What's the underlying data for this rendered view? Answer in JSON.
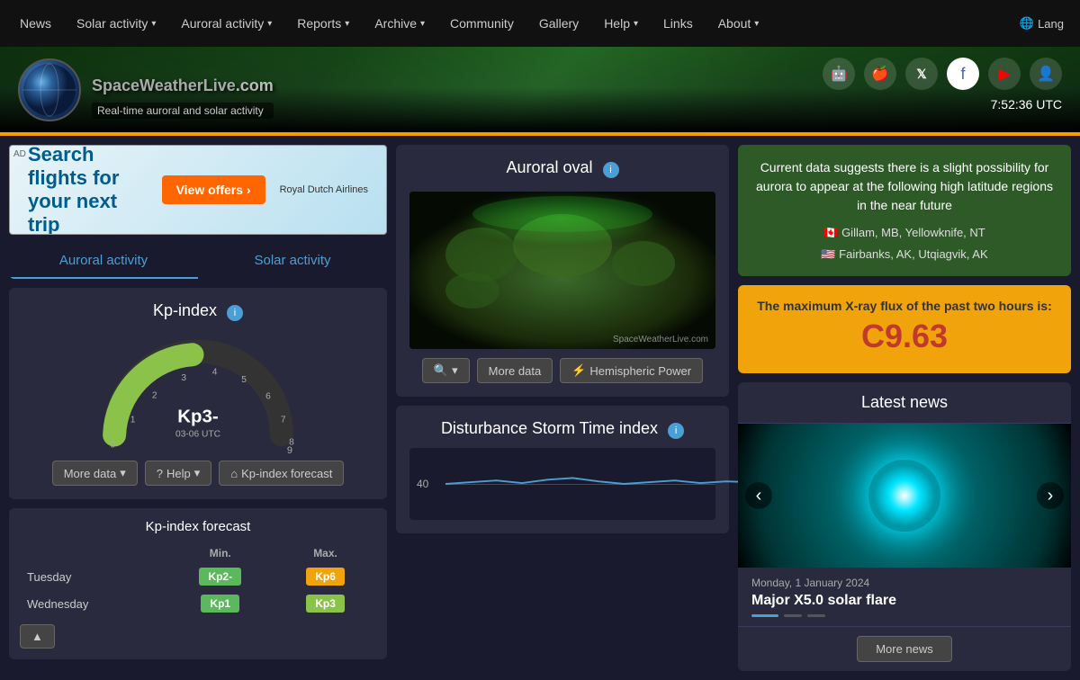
{
  "nav": {
    "items": [
      {
        "label": "News",
        "hasDropdown": false
      },
      {
        "label": "Solar activity",
        "hasDropdown": true
      },
      {
        "label": "Auroral activity",
        "hasDropdown": true
      },
      {
        "label": "Reports",
        "hasDropdown": true
      },
      {
        "label": "Archive",
        "hasDropdown": true
      },
      {
        "label": "Community",
        "hasDropdown": false
      },
      {
        "label": "Gallery",
        "hasDropdown": false
      },
      {
        "label": "Help",
        "hasDropdown": true
      },
      {
        "label": "Links",
        "hasDropdown": false
      },
      {
        "label": "About",
        "hasDropdown": true
      }
    ],
    "lang_label": "Lang"
  },
  "header": {
    "logo_title": "SpaceWeatherLive",
    "logo_com": ".com",
    "logo_subtitle": "Real-time auroral and solar activity",
    "time": "7:52:36 UTC"
  },
  "social": {
    "icons": [
      "android-icon",
      "apple-icon",
      "x-icon",
      "facebook-icon",
      "youtube-icon",
      "user-icon"
    ]
  },
  "ad": {
    "label": "AD",
    "headline": "Search flights for your next trip",
    "btn_label": "View offers ›",
    "logo": "Royal Dutch Airlines"
  },
  "auroral_activity": {
    "tab_label": "Auroral activity",
    "kp_title": "Kp-index",
    "kp_value": "Kp3-",
    "kp_time": "03-06 UTC",
    "gauge_max": 9,
    "gauge_ticks": [
      0,
      1,
      2,
      3,
      4,
      5,
      6,
      7,
      8,
      9
    ],
    "buttons": {
      "more_data": "More data",
      "help": "Help",
      "kp_forecast": "Kp-index forecast"
    }
  },
  "solar_activity": {
    "tab_label": "Solar activity"
  },
  "kp_forecast": {
    "title": "Kp-index forecast",
    "cols": [
      "",
      "Min.",
      "Max."
    ],
    "rows": [
      {
        "day": "Tuesday",
        "min": "Kp2-",
        "min_color": "green",
        "max": "Kp6",
        "max_color": "orange"
      },
      {
        "day": "Wednesday",
        "min": "Kp1",
        "min_color": "green",
        "max": "Kp3",
        "max_color": "lime"
      }
    ]
  },
  "auroral_oval": {
    "title": "Auroral oval",
    "watermark": "SpaceWeatherLive.com",
    "buttons": {
      "zoom": "🔍",
      "more_data": "More data",
      "hemispheric_power": "Hemispheric Power"
    }
  },
  "dst": {
    "title": "Disturbance Storm Time index",
    "y_label": "40"
  },
  "aurora_notice": {
    "text": "Current data suggests there is a slight possibility for aurora to appear at the following high latitude regions in the near future",
    "locations": [
      {
        "flag": "🇨🇦",
        "place": "Gillam, MB, Yellowknife, NT"
      },
      {
        "flag": "🇺🇸",
        "place": "Fairbanks, AK, Utqiagvik, AK"
      }
    ]
  },
  "xray": {
    "title": "The maximum X-ray flux of the past two hours is:",
    "value": "C9.63"
  },
  "news": {
    "title": "Latest news",
    "date": "Monday, 1 January 2024",
    "headline": "Major X5.0 solar flare",
    "more_label": "More news"
  }
}
